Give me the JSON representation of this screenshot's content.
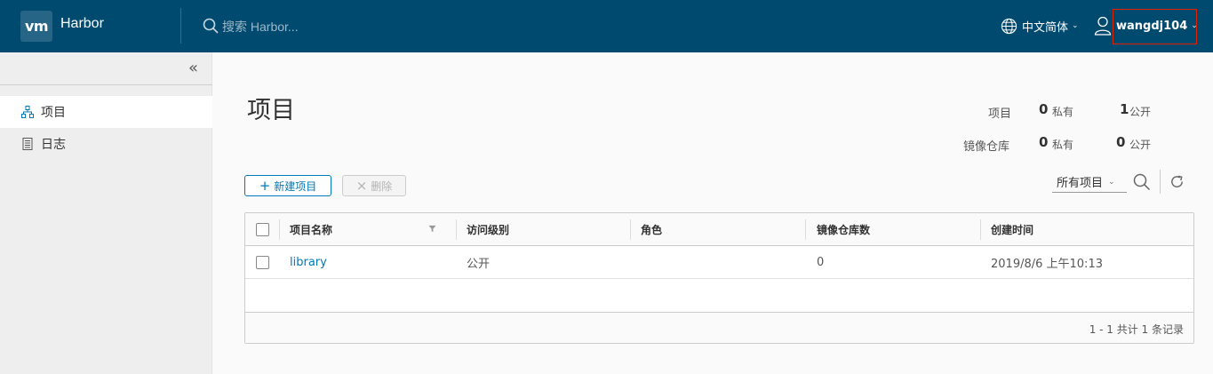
{
  "header": {
    "logo_text": "vm",
    "brand": "Harbor",
    "search_placeholder": "搜索 Harbor...",
    "language": "中文简体",
    "username": "wangdj104",
    "background_color": "#004a70",
    "highlight_color": "#e12200"
  },
  "sidebar": {
    "collapse_icon": "double-chevron-left-icon",
    "items": [
      {
        "label": "项目",
        "icon": "sitemap-icon",
        "active": true
      },
      {
        "label": "日志",
        "icon": "log-icon",
        "active": false
      }
    ]
  },
  "page": {
    "title": "项目",
    "summary": {
      "projects_label": "项目",
      "projects_private": "0",
      "projects_public": "1",
      "repos_label": "镜像仓库",
      "repos_private": "0",
      "repos_public": "0",
      "private_label": "私有",
      "public_label": "公开"
    },
    "toolbar": {
      "new_label": "新建项目",
      "delete_label": "删除",
      "filter_value": "所有项目"
    },
    "table": {
      "columns": [
        "项目名称",
        "访问级别",
        "角色",
        "镜像仓库数",
        "创建时间"
      ],
      "rows": [
        {
          "name": "library",
          "access": "公开",
          "role": "",
          "repo_count": "0",
          "created": "2019/8/6 上午10:13"
        }
      ],
      "footer": "1 - 1 共计 1 条记录"
    },
    "accent_color": "#0079b8"
  }
}
